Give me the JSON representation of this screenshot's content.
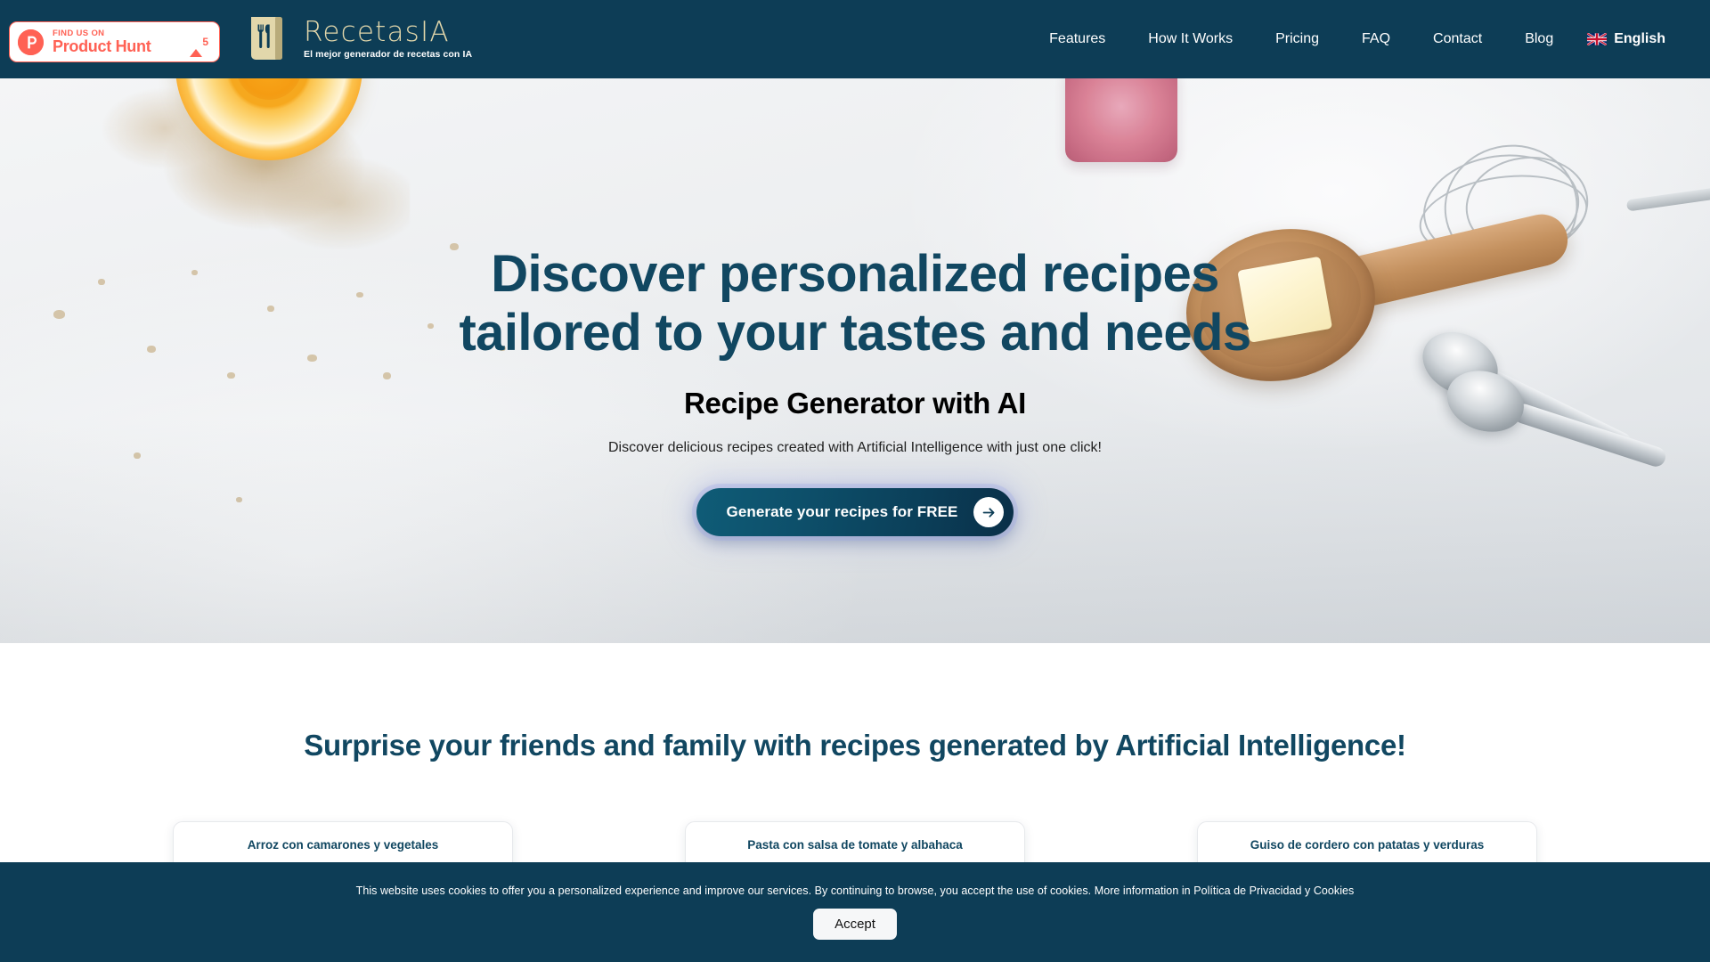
{
  "header": {
    "product_hunt": {
      "find_label": "FIND US ON",
      "name_label": "Product Hunt",
      "upvotes": "5",
      "icon": "product-hunt-logo-icon"
    },
    "brand": {
      "name": "RecetasIA",
      "tagline": "El mejor generador de recetas con IA",
      "icon": "recipe-book-cutlery-icon"
    },
    "nav_items": [
      {
        "label": "Features"
      },
      {
        "label": "How It Works"
      },
      {
        "label": "Pricing"
      },
      {
        "label": "FAQ"
      },
      {
        "label": "Contact"
      },
      {
        "label": "Blog"
      }
    ],
    "language": {
      "label": "English",
      "flag": "uk-flag-icon"
    },
    "background_color": "#0d3d56"
  },
  "hero": {
    "headline_line1": "Discover personalized recipes",
    "headline_line2": "tailored to your tastes and needs",
    "subheadline": "Recipe Generator with AI",
    "description": "Discover delicious recipes created with Artificial Intelligence with just one click!",
    "cta_label": "Generate your recipes for FREE",
    "cta_icon": "arrow-right-icon",
    "headline_color": "#114761",
    "cta_gradient_from": "#0f5c77",
    "cta_gradient_to": "#0a2f48"
  },
  "features_section": {
    "heading": "Surprise your friends and family with recipes generated by Artificial Intelligence!",
    "heading_color": "#114761",
    "cards": [
      {
        "title": "Arroz con camarones y vegetales"
      },
      {
        "title": "Pasta con salsa de tomate y albahaca"
      },
      {
        "title": "Guiso de cordero con patatas y verduras"
      }
    ]
  },
  "cookie_banner": {
    "text": "This website uses cookies to offer you a personalized experience and improve our services. By continuing to browse, you accept the use of cookies. More information in Política de Privacidad y Cookies",
    "accept_label": "Accept",
    "background_color": "#0d3d56"
  }
}
